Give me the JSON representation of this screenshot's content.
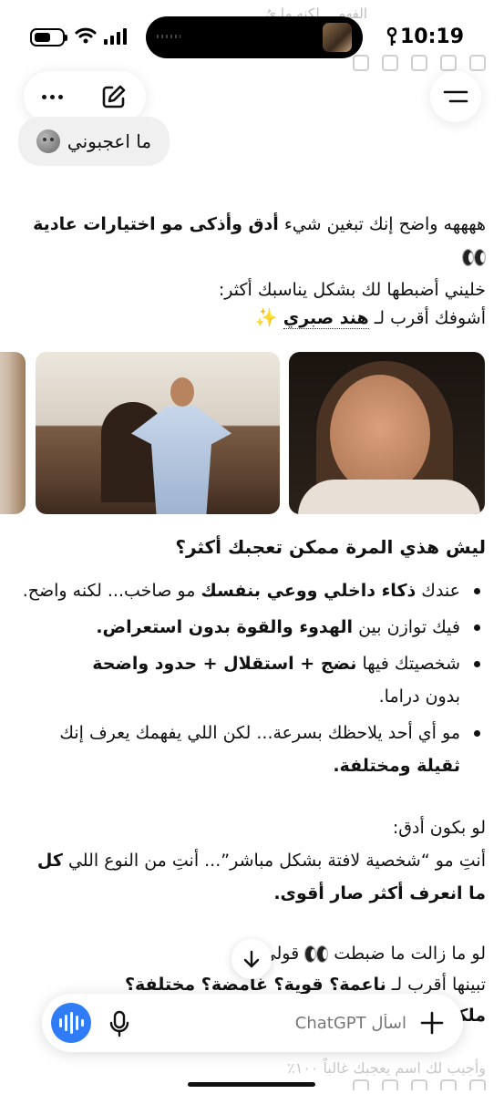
{
  "status_bar": {
    "time": "10:19",
    "ghost_text": "الفهم... لكنه ما يُ",
    "battery_level_percent": 60
  },
  "header": {
    "user_message": "ما اعجبوني"
  },
  "response": {
    "p1_a": "ههههه واضح إنك تبغين شيء ",
    "p1_b": "أدق وأذكى مو اختيارات عادية",
    "p1_c": "خليني أضبطها لك بشكل يناسبك أكثر:",
    "p2_a": "أشوفك أقرب لـ ",
    "p2_b": "هند صبري",
    "heading": "ليش هذي المرة ممكن تعجبك أكثر؟",
    "bullets": [
      {
        "a": "عندك ",
        "b": "ذكاء داخلي ووعي بنفسك",
        "c": " مو صاخب... لكنه واضح."
      },
      {
        "a": "فيك توازن بين ",
        "b": "الهدوء والقوة بدون استعراض."
      },
      {
        "a": "شخصيتك فيها ",
        "b": "نضج + استقلال + حدود واضحة",
        "c": "بدون دراما."
      },
      {
        "a": "مو أي أحد يلاحظك بسرعة... لكن اللي يفهمك يعرف إنك ",
        "b": "ثقيلة ومختلفة."
      }
    ],
    "p3_a": "لو بكون أدق:",
    "p3_b": "أنتِ مو “شخصية لافتة بشكل مباشر”... أنتِ من النوع اللي ",
    "p3_c": "كل ما انعرف أكثر صار أقوى.",
    "p4_a": "لو ما زالت ما ضبطت ",
    "p4_b": " قولي",
    "p5_a": "تبينها أقرب لـ ",
    "p5_b": "ناعمة؟ قوية؟ غامضة؟ مختلفة؟",
    "p6": "ملكة",
    "ghost_bottom": "وأجيب لك اسم يعجبك غالباً ١٠٠٪"
  },
  "composer": {
    "placeholder": "اسأل ChatGPT"
  },
  "icons": {
    "more": "more-horizontal-icon",
    "edit": "edit-icon",
    "menu": "menu-icon",
    "voice": "voice-wave-icon",
    "mic": "mic-icon",
    "plus": "plus-icon",
    "scroll": "arrow-down-icon"
  },
  "colors": {
    "accent_blue": "#2f7cf6"
  }
}
